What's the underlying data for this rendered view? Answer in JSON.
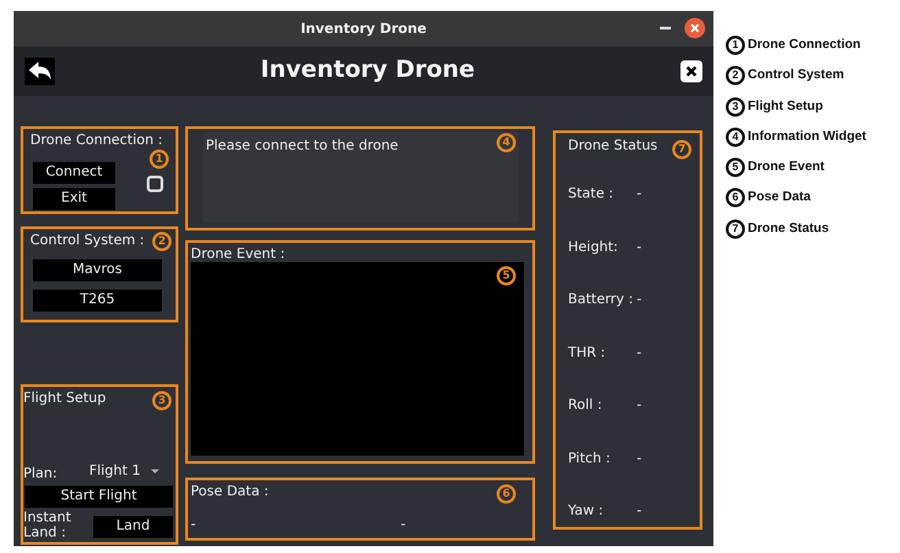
{
  "window": {
    "title": "Inventory Drone"
  },
  "header": {
    "title": "Inventory Drone"
  },
  "drone_connection": {
    "title": "Drone Connection :",
    "marker": "1",
    "buttons": [
      "Connect",
      "Exit"
    ],
    "checked": false
  },
  "control_system": {
    "title": "Control System :",
    "marker": "2",
    "buttons": [
      "Mavros",
      "T265"
    ]
  },
  "flight_setup": {
    "title": "Flight Setup",
    "marker": "3",
    "plan_label": "Plan:",
    "plan_value": "Flight 1",
    "start_button": "Start Flight",
    "land_label": "Instant Land :",
    "land_button": "Land"
  },
  "information": {
    "text": "Please connect to the drone",
    "marker": "4"
  },
  "drone_event": {
    "title": "Drone Event :",
    "marker": "5"
  },
  "pose_data": {
    "title": "Pose Data :",
    "marker": "6",
    "values": [
      "-",
      "-"
    ]
  },
  "drone_status": {
    "title": "Drone Status",
    "marker": "7",
    "rows": [
      {
        "label": "State :",
        "value": "-"
      },
      {
        "label": "Height:",
        "value": "-"
      },
      {
        "label": "Batterry :",
        "value": "-"
      },
      {
        "label": "THR :",
        "value": "-"
      },
      {
        "label": "Roll :",
        "value": "-"
      },
      {
        "label": "Pitch :",
        "value": "-"
      },
      {
        "label": "Yaw :",
        "value": "-"
      }
    ]
  },
  "legend": [
    {
      "number": "1",
      "label": "Drone Connection"
    },
    {
      "number": "2",
      "label": "Control System"
    },
    {
      "number": "3",
      "label": "Flight Setup"
    },
    {
      "number": "4",
      "label": "Information Widget"
    },
    {
      "number": "5",
      "label": "Drone Event"
    },
    {
      "number": "6",
      "label": "Pose Data"
    },
    {
      "number": "7",
      "label": "Drone Status"
    }
  ]
}
